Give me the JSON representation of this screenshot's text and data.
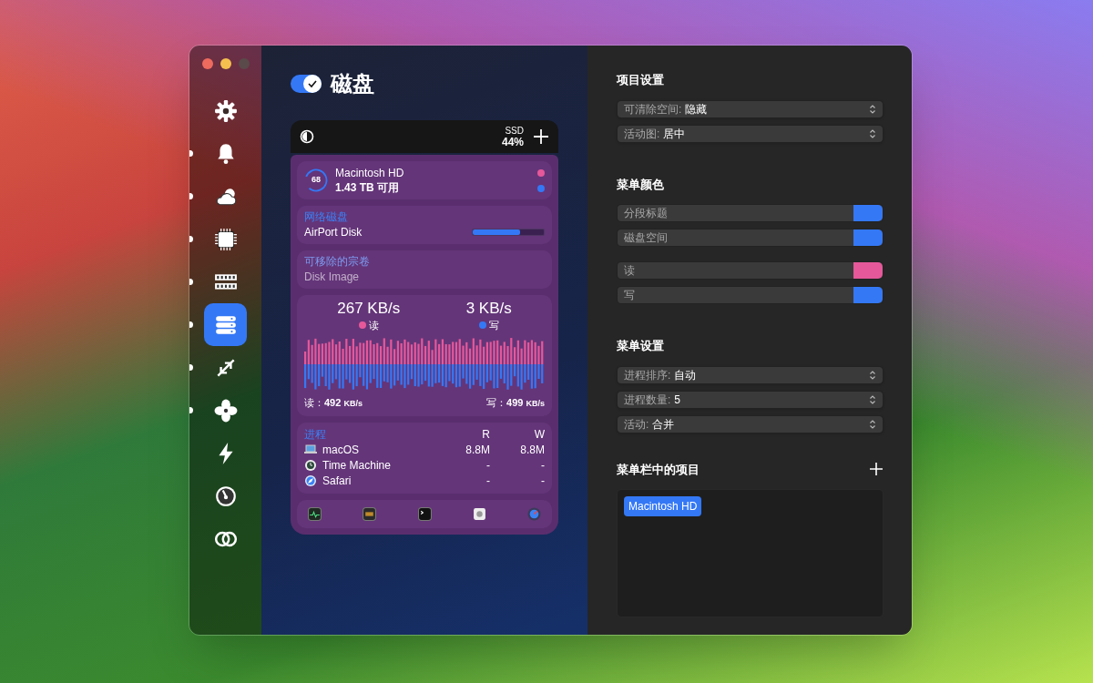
{
  "sidebar": {
    "items": [
      {
        "kind": "gear",
        "selected": false,
        "enabled": false
      },
      {
        "kind": "bell",
        "selected": false,
        "enabled": true
      },
      {
        "kind": "cloud",
        "selected": false,
        "enabled": true
      },
      {
        "kind": "chip",
        "selected": false,
        "enabled": true
      },
      {
        "kind": "memory",
        "selected": false,
        "enabled": true
      },
      {
        "kind": "disk",
        "selected": true,
        "enabled": true
      },
      {
        "kind": "arrows",
        "selected": false,
        "enabled": true
      },
      {
        "kind": "fan",
        "selected": false,
        "enabled": true
      },
      {
        "kind": "bolt",
        "selected": false,
        "enabled": false
      },
      {
        "kind": "gauge",
        "selected": false,
        "enabled": false
      },
      {
        "kind": "rings",
        "selected": false,
        "enabled": false
      }
    ]
  },
  "module": {
    "title": "磁盘",
    "enabled": true
  },
  "preview": {
    "header": {
      "type": "SSD",
      "usage": "44%"
    },
    "disks": [
      {
        "kind": "main",
        "ring": "68",
        "name": "Macintosh HD",
        "detail": "1.43 TB 可用",
        "dots": [
          {
            "color": "#e5589a"
          },
          {
            "color": "#3478f6"
          }
        ]
      },
      {
        "kind": "network",
        "section": "网络磁盘",
        "name": "AirPort Disk",
        "level": 0.67,
        "disabled": false
      },
      {
        "kind": "network",
        "section": "可移除的宗卷",
        "name": "Disk Image",
        "disabled": true
      }
    ],
    "activity": {
      "read_speed": "267 KB/s",
      "read_label": "读",
      "write_speed": "3 KB/s",
      "write_label": "写",
      "read_total_label": "读：",
      "read_total": "492",
      "write_total_label": "写：",
      "write_total": "499",
      "read_unit": "KB/s",
      "write_unit": "KB/s"
    },
    "processes": {
      "title": "进程",
      "columns": [
        "R",
        "W"
      ],
      "rows": [
        {
          "kind": "laptop",
          "name": "macOS",
          "r": "8.8M",
          "w": "8.8M"
        },
        {
          "kind": "clock",
          "name": "Time Machine",
          "r": "-",
          "w": "-"
        },
        {
          "kind": "compass",
          "name": "Safari",
          "r": "-",
          "w": "-"
        }
      ]
    },
    "dock": [
      {
        "kind": "monitor"
      },
      {
        "kind": "console"
      },
      {
        "kind": "terminal"
      },
      {
        "kind": "disk-utility"
      },
      {
        "kind": "gauge"
      }
    ]
  },
  "settings": [
    {
      "kind": "popups",
      "title": "项目设置",
      "items": [
        {
          "label": "可清除空间:",
          "value": "隐藏"
        },
        {
          "label": "活动图:",
          "value": "居中"
        }
      ]
    },
    {
      "kind": "colors",
      "title": "菜单颜色",
      "groups": [
        {
          "items": [
            {
              "label": "分段标题",
              "color": "#3478f6"
            },
            {
              "label": "磁盘空间",
              "color": "#3478f6"
            }
          ]
        },
        {
          "items": [
            {
              "label": "读",
              "color": "#e5589a"
            },
            {
              "label": "写",
              "color": "#3478f6"
            }
          ]
        }
      ]
    },
    {
      "kind": "popups",
      "title": "菜单设置",
      "items": [
        {
          "label": "进程排序:",
          "value": "自动"
        },
        {
          "label": "进程数量:",
          "value": "5"
        },
        {
          "label": "活动:",
          "value": "合并"
        }
      ]
    },
    {
      "kind": "list",
      "title": "菜单栏中的项目",
      "items": [
        {
          "label": "Macintosh HD"
        }
      ]
    }
  ]
}
